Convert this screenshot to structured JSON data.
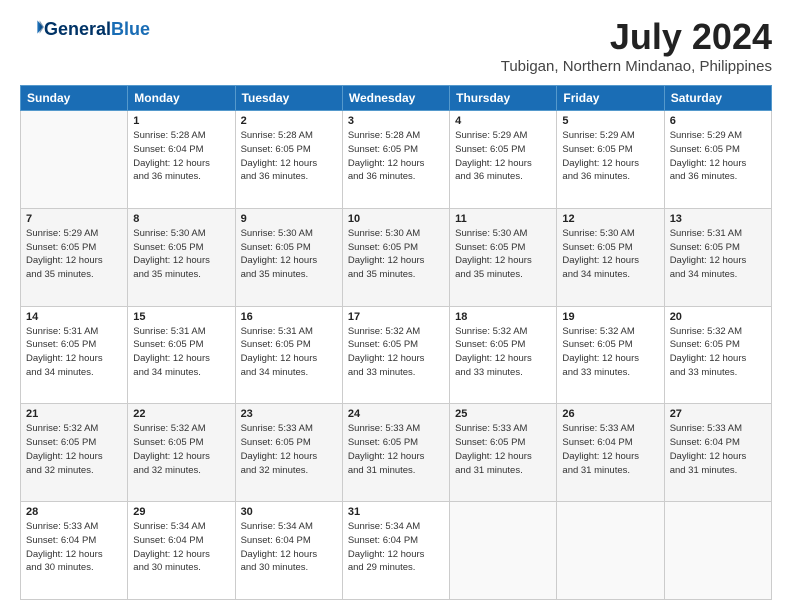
{
  "header": {
    "logo_line1": "General",
    "logo_line2": "Blue",
    "title": "July 2024",
    "subtitle": "Tubigan, Northern Mindanao, Philippines"
  },
  "calendar": {
    "columns": [
      "Sunday",
      "Monday",
      "Tuesday",
      "Wednesday",
      "Thursday",
      "Friday",
      "Saturday"
    ],
    "weeks": [
      [
        {
          "day": "",
          "info": ""
        },
        {
          "day": "1",
          "info": "Sunrise: 5:28 AM\nSunset: 6:04 PM\nDaylight: 12 hours\nand 36 minutes."
        },
        {
          "day": "2",
          "info": "Sunrise: 5:28 AM\nSunset: 6:05 PM\nDaylight: 12 hours\nand 36 minutes."
        },
        {
          "day": "3",
          "info": "Sunrise: 5:28 AM\nSunset: 6:05 PM\nDaylight: 12 hours\nand 36 minutes."
        },
        {
          "day": "4",
          "info": "Sunrise: 5:29 AM\nSunset: 6:05 PM\nDaylight: 12 hours\nand 36 minutes."
        },
        {
          "day": "5",
          "info": "Sunrise: 5:29 AM\nSunset: 6:05 PM\nDaylight: 12 hours\nand 36 minutes."
        },
        {
          "day": "6",
          "info": "Sunrise: 5:29 AM\nSunset: 6:05 PM\nDaylight: 12 hours\nand 36 minutes."
        }
      ],
      [
        {
          "day": "7",
          "info": "Sunrise: 5:29 AM\nSunset: 6:05 PM\nDaylight: 12 hours\nand 35 minutes."
        },
        {
          "day": "8",
          "info": "Sunrise: 5:30 AM\nSunset: 6:05 PM\nDaylight: 12 hours\nand 35 minutes."
        },
        {
          "day": "9",
          "info": "Sunrise: 5:30 AM\nSunset: 6:05 PM\nDaylight: 12 hours\nand 35 minutes."
        },
        {
          "day": "10",
          "info": "Sunrise: 5:30 AM\nSunset: 6:05 PM\nDaylight: 12 hours\nand 35 minutes."
        },
        {
          "day": "11",
          "info": "Sunrise: 5:30 AM\nSunset: 6:05 PM\nDaylight: 12 hours\nand 35 minutes."
        },
        {
          "day": "12",
          "info": "Sunrise: 5:30 AM\nSunset: 6:05 PM\nDaylight: 12 hours\nand 34 minutes."
        },
        {
          "day": "13",
          "info": "Sunrise: 5:31 AM\nSunset: 6:05 PM\nDaylight: 12 hours\nand 34 minutes."
        }
      ],
      [
        {
          "day": "14",
          "info": "Sunrise: 5:31 AM\nSunset: 6:05 PM\nDaylight: 12 hours\nand 34 minutes."
        },
        {
          "day": "15",
          "info": "Sunrise: 5:31 AM\nSunset: 6:05 PM\nDaylight: 12 hours\nand 34 minutes."
        },
        {
          "day": "16",
          "info": "Sunrise: 5:31 AM\nSunset: 6:05 PM\nDaylight: 12 hours\nand 34 minutes."
        },
        {
          "day": "17",
          "info": "Sunrise: 5:32 AM\nSunset: 6:05 PM\nDaylight: 12 hours\nand 33 minutes."
        },
        {
          "day": "18",
          "info": "Sunrise: 5:32 AM\nSunset: 6:05 PM\nDaylight: 12 hours\nand 33 minutes."
        },
        {
          "day": "19",
          "info": "Sunrise: 5:32 AM\nSunset: 6:05 PM\nDaylight: 12 hours\nand 33 minutes."
        },
        {
          "day": "20",
          "info": "Sunrise: 5:32 AM\nSunset: 6:05 PM\nDaylight: 12 hours\nand 33 minutes."
        }
      ],
      [
        {
          "day": "21",
          "info": "Sunrise: 5:32 AM\nSunset: 6:05 PM\nDaylight: 12 hours\nand 32 minutes."
        },
        {
          "day": "22",
          "info": "Sunrise: 5:32 AM\nSunset: 6:05 PM\nDaylight: 12 hours\nand 32 minutes."
        },
        {
          "day": "23",
          "info": "Sunrise: 5:33 AM\nSunset: 6:05 PM\nDaylight: 12 hours\nand 32 minutes."
        },
        {
          "day": "24",
          "info": "Sunrise: 5:33 AM\nSunset: 6:05 PM\nDaylight: 12 hours\nand 31 minutes."
        },
        {
          "day": "25",
          "info": "Sunrise: 5:33 AM\nSunset: 6:05 PM\nDaylight: 12 hours\nand 31 minutes."
        },
        {
          "day": "26",
          "info": "Sunrise: 5:33 AM\nSunset: 6:04 PM\nDaylight: 12 hours\nand 31 minutes."
        },
        {
          "day": "27",
          "info": "Sunrise: 5:33 AM\nSunset: 6:04 PM\nDaylight: 12 hours\nand 31 minutes."
        }
      ],
      [
        {
          "day": "28",
          "info": "Sunrise: 5:33 AM\nSunset: 6:04 PM\nDaylight: 12 hours\nand 30 minutes."
        },
        {
          "day": "29",
          "info": "Sunrise: 5:34 AM\nSunset: 6:04 PM\nDaylight: 12 hours\nand 30 minutes."
        },
        {
          "day": "30",
          "info": "Sunrise: 5:34 AM\nSunset: 6:04 PM\nDaylight: 12 hours\nand 30 minutes."
        },
        {
          "day": "31",
          "info": "Sunrise: 5:34 AM\nSunset: 6:04 PM\nDaylight: 12 hours\nand 29 minutes."
        },
        {
          "day": "",
          "info": ""
        },
        {
          "day": "",
          "info": ""
        },
        {
          "day": "",
          "info": ""
        }
      ]
    ]
  }
}
